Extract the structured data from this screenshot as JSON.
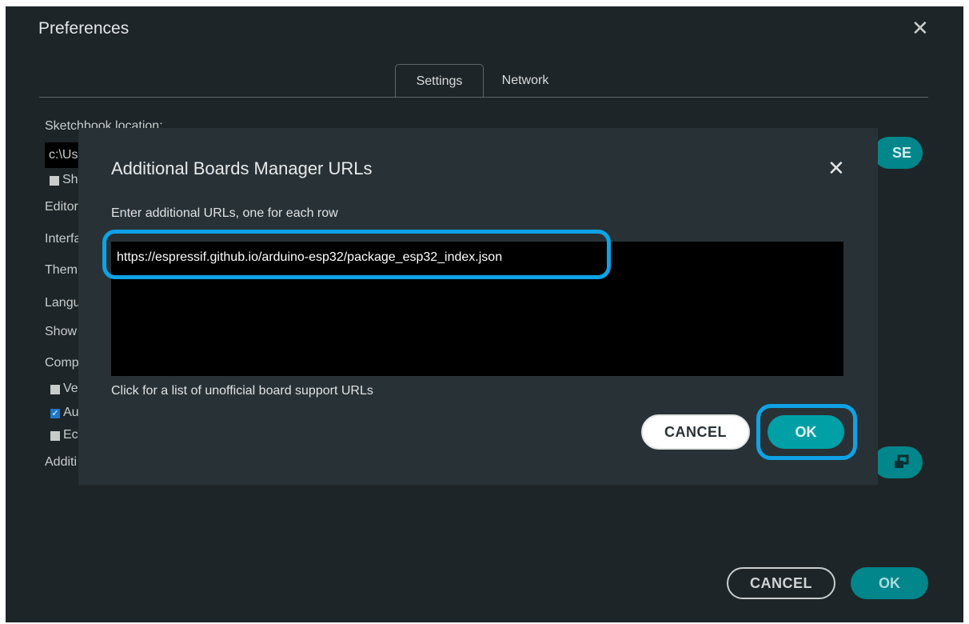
{
  "window": {
    "title": "Preferences",
    "close_glyph": "✕"
  },
  "tabs": [
    {
      "label": "Settings",
      "active": true
    },
    {
      "label": "Network",
      "active": false
    }
  ],
  "settings": {
    "sketchbook_label": "Sketchbook location:",
    "sketchbook_path_visible": "c:\\Us",
    "show_files_label_visible": "Sh",
    "editor_label_visible": "Editor",
    "interface_label_visible": "Interfa",
    "theme_label_visible": "Them",
    "language_label_visible": "Langu",
    "show_label_visible": "Show",
    "compiler_label_visible": "Comp",
    "verify_label_visible": "Ve",
    "auto_label_visible": "Au",
    "editor_quick_label_visible": "Ec",
    "additional_label_visible": "Additi",
    "browse_button_visible": "SE"
  },
  "footer": {
    "cancel_label": "CANCEL",
    "ok_label": "OK"
  },
  "dialog": {
    "title": "Additional Boards Manager URLs",
    "close_glyph": "✕",
    "instruction": "Enter additional URLs, one for each row",
    "urls": [
      "https://espressif.github.io/arduino-esp32/package_esp32_index.json"
    ],
    "help_link": "Click for a list of unofficial board support URLs",
    "cancel_label": "CANCEL",
    "ok_label": "OK"
  },
  "colors": {
    "window_bg": "#1d2528",
    "dialog_bg": "#283236",
    "accent_teal": "#00a0a6",
    "highlight_blue": "#0ea2e6"
  },
  "icons": {
    "window_close": "close-icon",
    "dialog_close": "close-icon",
    "urls_edit": "window-stack-icon",
    "checkbox_checked": "checkmark-icon"
  }
}
